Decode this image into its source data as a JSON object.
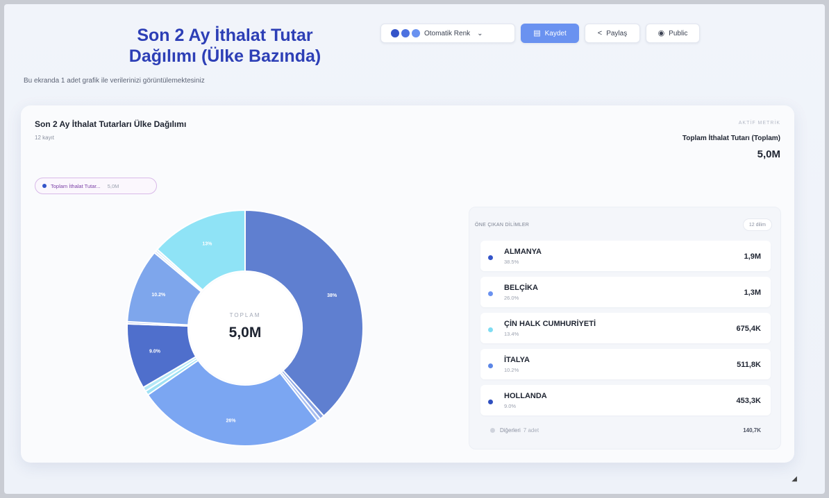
{
  "header": {
    "title": "Son 2 Ay İthalat Tutar Dağılımı (Ülke Bazında)",
    "subtitle": "Bu ekranda 1 adet grafik ile verilerinizi görüntülemektesiniz"
  },
  "toolbar": {
    "color_label": "Otomatik Renk",
    "save_label": "Kaydet",
    "share_label": "Paylaş",
    "public_label": "Public",
    "color_dots": [
      "#3454c9",
      "#4d72e0",
      "#6a92f0"
    ]
  },
  "card": {
    "title": "Son 2 Ay İthalat Tutarları Ülke Dağılımı",
    "count": "12 kayıt",
    "metric_label": "AKTİF METRİK",
    "metric_name": "Toplam İthalat Tutarı (Toplam)",
    "metric_value": "5,0M",
    "legend_pill_label": "Toplam İthalat Tutar...",
    "legend_pill_value": "5,0M"
  },
  "chart_data": {
    "type": "pie",
    "center_label": "TOPLAM",
    "center_value": "5,0M",
    "slices": [
      {
        "label": "ALMANYA",
        "value": 38.5,
        "data_label": "38%",
        "color": "#5f7fd0"
      },
      {
        "label": "Diğer 1",
        "value": 0.6,
        "data_label": "",
        "color": "#8aa4e4"
      },
      {
        "label": "Diğer 2",
        "value": 0.5,
        "data_label": "",
        "color": "#a9bff0"
      },
      {
        "label": "BELÇİKA",
        "value": 26.0,
        "data_label": "26%",
        "color": "#7ba6f2"
      },
      {
        "label": "Diğer 3",
        "value": 0.6,
        "data_label": "",
        "color": "#9fe1f4"
      },
      {
        "label": "Diğer 4",
        "value": 0.6,
        "data_label": "",
        "color": "#b5e9f7"
      },
      {
        "label": "HOLLANDA",
        "value": 9.0,
        "data_label": "9.0%",
        "color": "#4f6fcc"
      },
      {
        "label": "Diğer 5",
        "value": 0.3,
        "data_label": "",
        "color": "#c7d3f0"
      },
      {
        "label": "İTALYA",
        "value": 10.2,
        "data_label": "10.2%",
        "color": "#7ea6ec"
      },
      {
        "label": "Diğer 6",
        "value": 0.3,
        "data_label": "",
        "color": "#d7e2f5"
      },
      {
        "label": "Diğer 7",
        "value": 0.3,
        "data_label": "",
        "color": "#cde6f5"
      },
      {
        "label": "ÇİN HALK CUMHURİYETİ",
        "value": 13.4,
        "data_label": "13%",
        "color": "#8fe3f6"
      }
    ]
  },
  "list": {
    "header": "ÖNE ÇIKAN DİLİMLER",
    "badge": "12 dilim",
    "items": [
      {
        "name": "ALMANYA",
        "pct": "38.5%",
        "amount": "1,9M",
        "color": "#3454c9"
      },
      {
        "name": "BELÇİKA",
        "pct": "26.0%",
        "amount": "1,3M",
        "color": "#6a92f0"
      },
      {
        "name": "ÇİN HALK CUMHURİYETİ",
        "pct": "13.4%",
        "amount": "675,4K",
        "color": "#7fdcf2"
      },
      {
        "name": "İTALYA",
        "pct": "10.2%",
        "amount": "511,8K",
        "color": "#5c86e6"
      },
      {
        "name": "HOLLANDA",
        "pct": "9.0%",
        "amount": "453,3K",
        "color": "#2f4fbf"
      }
    ],
    "others": {
      "name": "Diğerleri",
      "sub": "7 adet",
      "amount": "140,7K"
    }
  }
}
